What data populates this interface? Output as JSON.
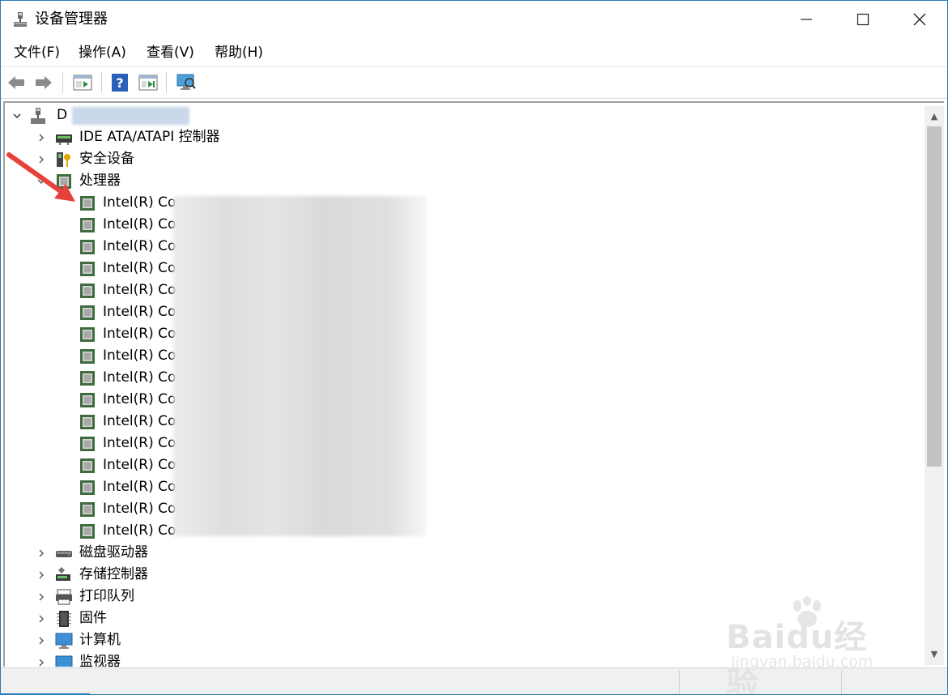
{
  "window": {
    "title": "设备管理器",
    "minimize_glyph": "—",
    "maximize_glyph": "☐",
    "close_glyph": "✕"
  },
  "menu": [
    "文件(F)",
    "操作(A)",
    "查看(V)",
    "帮助(H)"
  ],
  "toolbar": {
    "buttons": [
      "back-icon",
      "forward-icon",
      "properties-icon",
      "help-icon",
      "update-driver-icon",
      "scan-hardware-icon"
    ]
  },
  "tree": {
    "root_label": "D",
    "categories_top": [
      {
        "label": "IDE ATA/ATAPI 控制器",
        "icon": "ide-controller-icon"
      },
      {
        "label": "安全设备",
        "icon": "security-device-icon"
      },
      {
        "label": "处理器",
        "icon": "processor-icon",
        "expanded": true
      }
    ],
    "processors": [
      "Intel(R) Co",
      "Intel(R) Co",
      "Intel(R) Co",
      "Intel(R) Co",
      "Intel(R) Co",
      "Intel(R) Co",
      "Intel(R) Co",
      "Intel(R) Co",
      "Intel(R) Co",
      "Intel(R) Co",
      "Intel(R) Co",
      "Intel(R) Co",
      "Intel(R) Co",
      "Intel(R) Co",
      "Intel(R) Co",
      "Intel(R) Co"
    ],
    "categories_bottom": [
      {
        "label": "磁盘驱动器",
        "icon": "disk-drive-icon"
      },
      {
        "label": "存储控制器",
        "icon": "storage-controller-icon"
      },
      {
        "label": "打印队列",
        "icon": "print-queue-icon"
      },
      {
        "label": "固件",
        "icon": "firmware-icon"
      },
      {
        "label": "计算机",
        "icon": "computer-icon"
      },
      {
        "label": "监视器",
        "icon": "monitor-icon"
      }
    ]
  },
  "watermark": {
    "brand": "Baidu经验",
    "url": "jingyan.baidu.com"
  },
  "colors": {
    "accent": "#2a7ab8",
    "arrow": "#e8403a",
    "chip": "#3f6b3f"
  }
}
